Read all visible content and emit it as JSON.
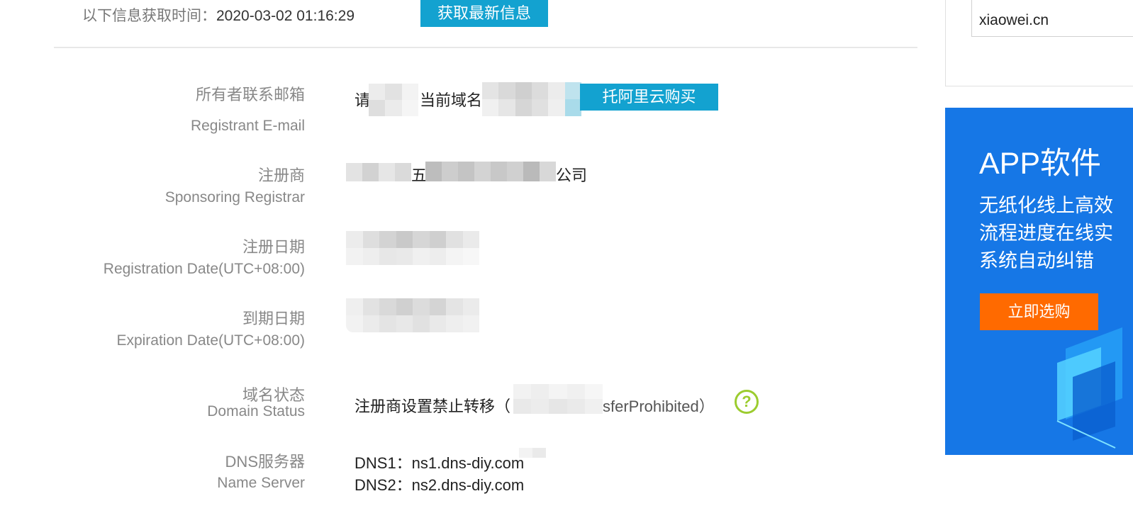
{
  "header": {
    "time_label": "以下信息获取时间：",
    "time_value": "2020-03-02 01:16:29",
    "refresh_button": "获取最新信息"
  },
  "rows": {
    "email": {
      "label_cn": "所有者联系邮箱",
      "label_en": "Registrant E-mail",
      "value_prefix": "请",
      "value_middle": "当前域名注",
      "buy_button": "托阿里云购买"
    },
    "registrar": {
      "label_cn": "注册商",
      "label_en": "Sponsoring Registrar",
      "value_visible_1": "五",
      "value_visible_2": "公司"
    },
    "reg_date": {
      "label_cn": "注册日期",
      "label_en": "Registration Date(UTC+08:00)"
    },
    "exp_date": {
      "label_cn": "到期日期",
      "label_en": "Expiration Date(UTC+08:00)"
    },
    "status": {
      "label_cn": "域名状态",
      "label_en": "Domain Status",
      "value_cn": "注册商设置禁止转移（",
      "value_en_tail": "sferProhibited）"
    },
    "dns": {
      "label_cn": "DNS服务器",
      "label_en": "Name Server",
      "servers": [
        "DNS1：ns1.dns-diy.com",
        "DNS2：ns2.dns-diy.com"
      ]
    }
  },
  "sidebar": {
    "search_value": "xiaowei.cn",
    "ad": {
      "title": "APP软件",
      "lines": [
        "无纸化线上高效",
        "流程进度在线实",
        "系统自动纠错"
      ],
      "button": "立即选购",
      "background": "#1677e6",
      "button_color": "#ff6a00"
    }
  },
  "colors": {
    "accent": "#13a2d0",
    "help_icon": "#9ccc2f"
  },
  "icons": {
    "help": "question-circle-icon"
  }
}
